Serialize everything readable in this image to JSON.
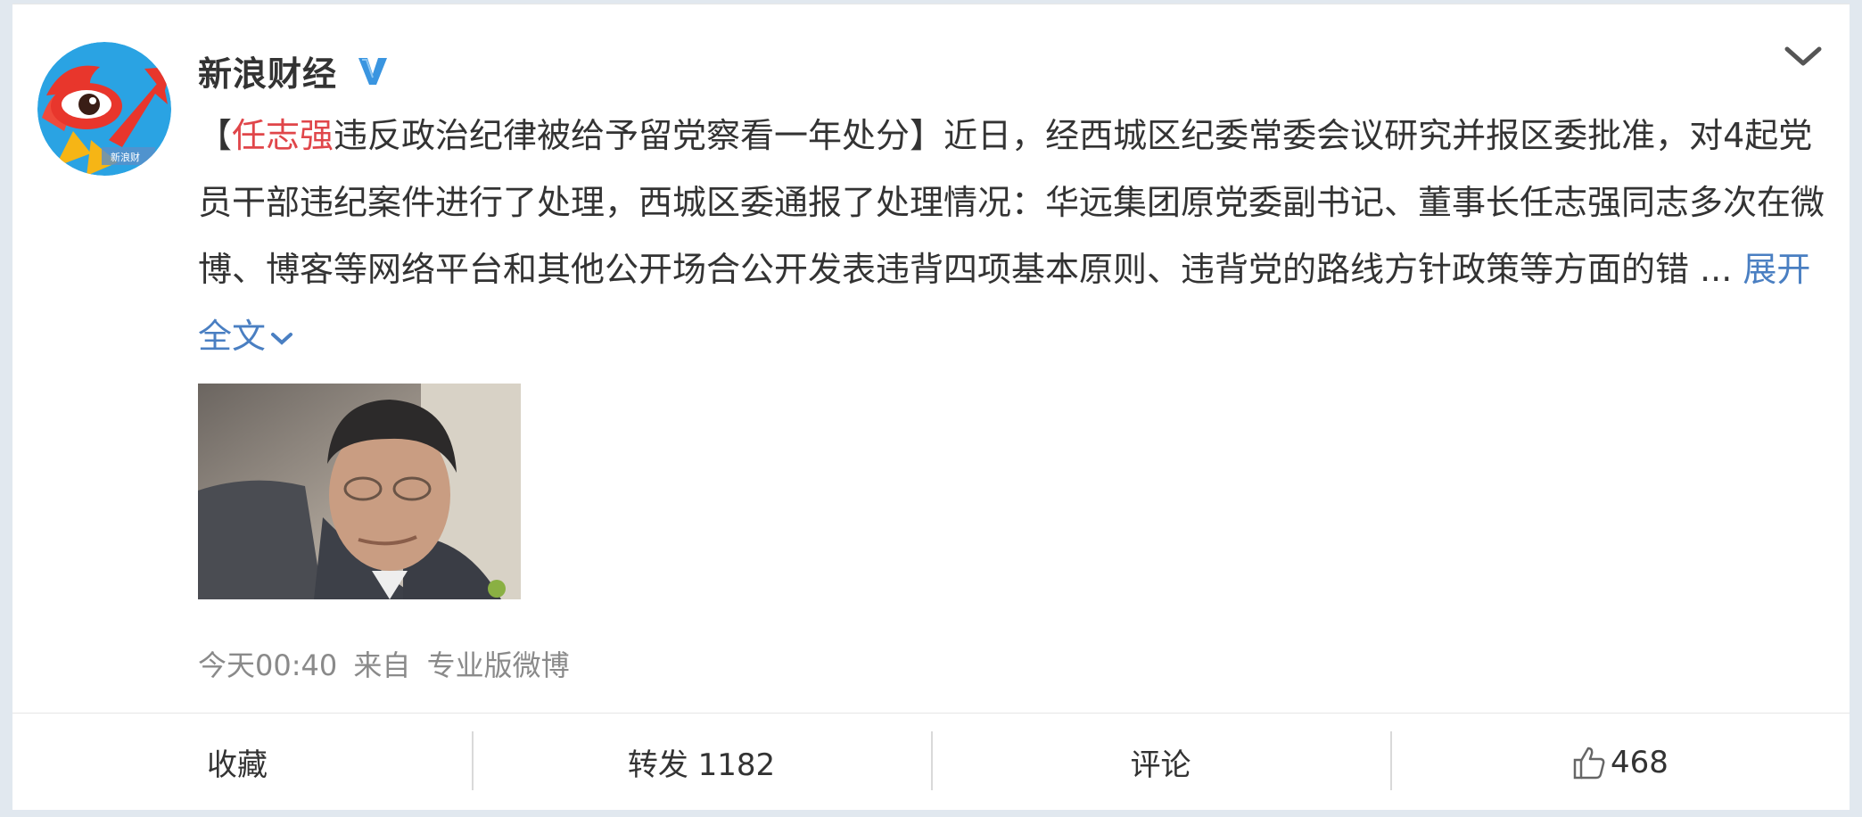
{
  "post": {
    "author": "新浪财经",
    "verified_icon": "verified-v-icon",
    "content": {
      "bracket_open": "【",
      "highlight_name": "任志强",
      "headline_rest": "违反政治纪律被给予留党察看一年处分",
      "bracket_close": "】",
      "body": "近日，经西城区纪委常委会议研究并报区委批准，对4起党员干部违纪案件进行了处理，西城区委通报了处理情况：华远集团原党委副书记、董事长任志强同志多次在微博、博客等网络平台和其他公开场合公开发表违背四项基本原则、违背党的路线方针政策等方面的错 ...",
      "expand_label": "展开全文"
    },
    "time": "今天00:40",
    "source_prefix": "来自",
    "source": "专业版微博"
  },
  "actions": {
    "favorite_label": "收藏",
    "repost_label": "转发 1182",
    "comment_label": "评论",
    "like_count": "468"
  },
  "colors": {
    "highlight": "#e0464a",
    "link": "#4a7fc2",
    "verified": "#3a95e0"
  }
}
